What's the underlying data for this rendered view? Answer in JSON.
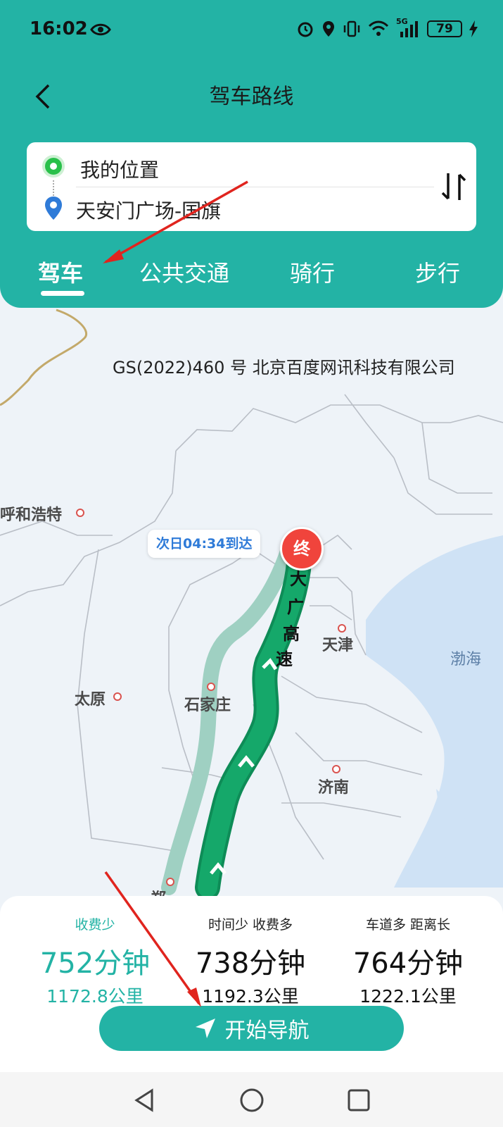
{
  "status_bar": {
    "time": "16:02",
    "network": "5G",
    "battery": "79"
  },
  "header": {
    "title": "驾车路线"
  },
  "route": {
    "origin": "我的位置",
    "destination": "天安门广场-国旗"
  },
  "tabs": [
    {
      "label": "驾车",
      "active": true
    },
    {
      "label": "公共交通",
      "active": false
    },
    {
      "label": "骑行",
      "active": false
    },
    {
      "label": "步行",
      "active": false
    }
  ],
  "map": {
    "copyright": "GS(2022)460 号 北京百度网讯科技有限公司",
    "arrival_label": "次日04:34到达",
    "end_marker_label": "终",
    "road_label": "大广高速",
    "cities": [
      "呼和浩特",
      "太原",
      "石家庄",
      "天津",
      "济南",
      "郑"
    ],
    "sea": "渤海"
  },
  "plans": [
    {
      "tag": "收费少",
      "time": "752分钟",
      "distance": "1172.8公里",
      "active": true
    },
    {
      "tag": "时间少  收费多",
      "time": "738分钟",
      "distance": "1192.3公里",
      "active": false
    },
    {
      "tag": "车道多  距离长",
      "time": "764分钟",
      "distance": "1222.1公里",
      "active": false
    }
  ],
  "navigate_button": "开始导航",
  "colors": {
    "primary": "#23b3a5",
    "route_main": "#15a86a",
    "route_alt": "#9fd0c2",
    "end_marker": "#f0443c",
    "annotation": "#e0241e"
  }
}
